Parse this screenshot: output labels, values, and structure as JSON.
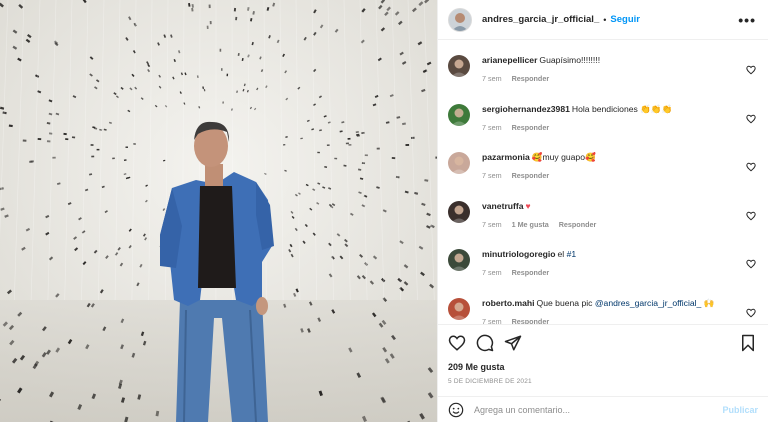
{
  "post": {
    "username": "andres_garcia_jr_official_",
    "follow_label": "Seguir",
    "dot": "•",
    "more": "•••"
  },
  "comments": [
    {
      "user": "arianepellicer",
      "text": "Guapísimo!!!!!!!!",
      "time": "7 sem",
      "likes": "",
      "reply": "Responder",
      "avatar_color": "#5a4a40"
    },
    {
      "user": "sergiohernandez3981",
      "text": "Hola bendiciones 👏👏👏",
      "time": "7 sem",
      "likes": "",
      "reply": "Responder",
      "avatar_color": "#3e7a3a"
    },
    {
      "user": "pazarmonia",
      "text": "🥰muy guapo🥰",
      "time": "7 sem",
      "likes": "",
      "reply": "Responder",
      "avatar_color": "#c9a89a"
    },
    {
      "user": "vanetruffa",
      "text": "♥",
      "time": "7 sem",
      "likes": "1 Me gusta",
      "reply": "Responder",
      "avatar_color": "#3a2f2c"
    },
    {
      "user": "minutriologoregio",
      "text": "el ",
      "mention": "#1",
      "time": "7 sem",
      "likes": "",
      "reply": "Responder",
      "avatar_color": "#3c4a3a"
    },
    {
      "user": "roberto.mahi",
      "text": "Que buena pic ",
      "mention": "@andres_garcia_jr_official_",
      "suffix": " 🙌",
      "time": "7 sem",
      "likes": "",
      "reply": "Responder",
      "avatar_color": "#b7503a"
    }
  ],
  "footer": {
    "likes": "209 Me gusta",
    "date": "5 DE DICIEMBRE DE 2021",
    "comment_placeholder": "Agrega un comentario...",
    "publish_label": "Publicar"
  },
  "colors": {
    "follow": "#0095f6",
    "mention": "#00376b",
    "publish_disabled": "#b2dffc",
    "heart_red": "#ed4956"
  }
}
